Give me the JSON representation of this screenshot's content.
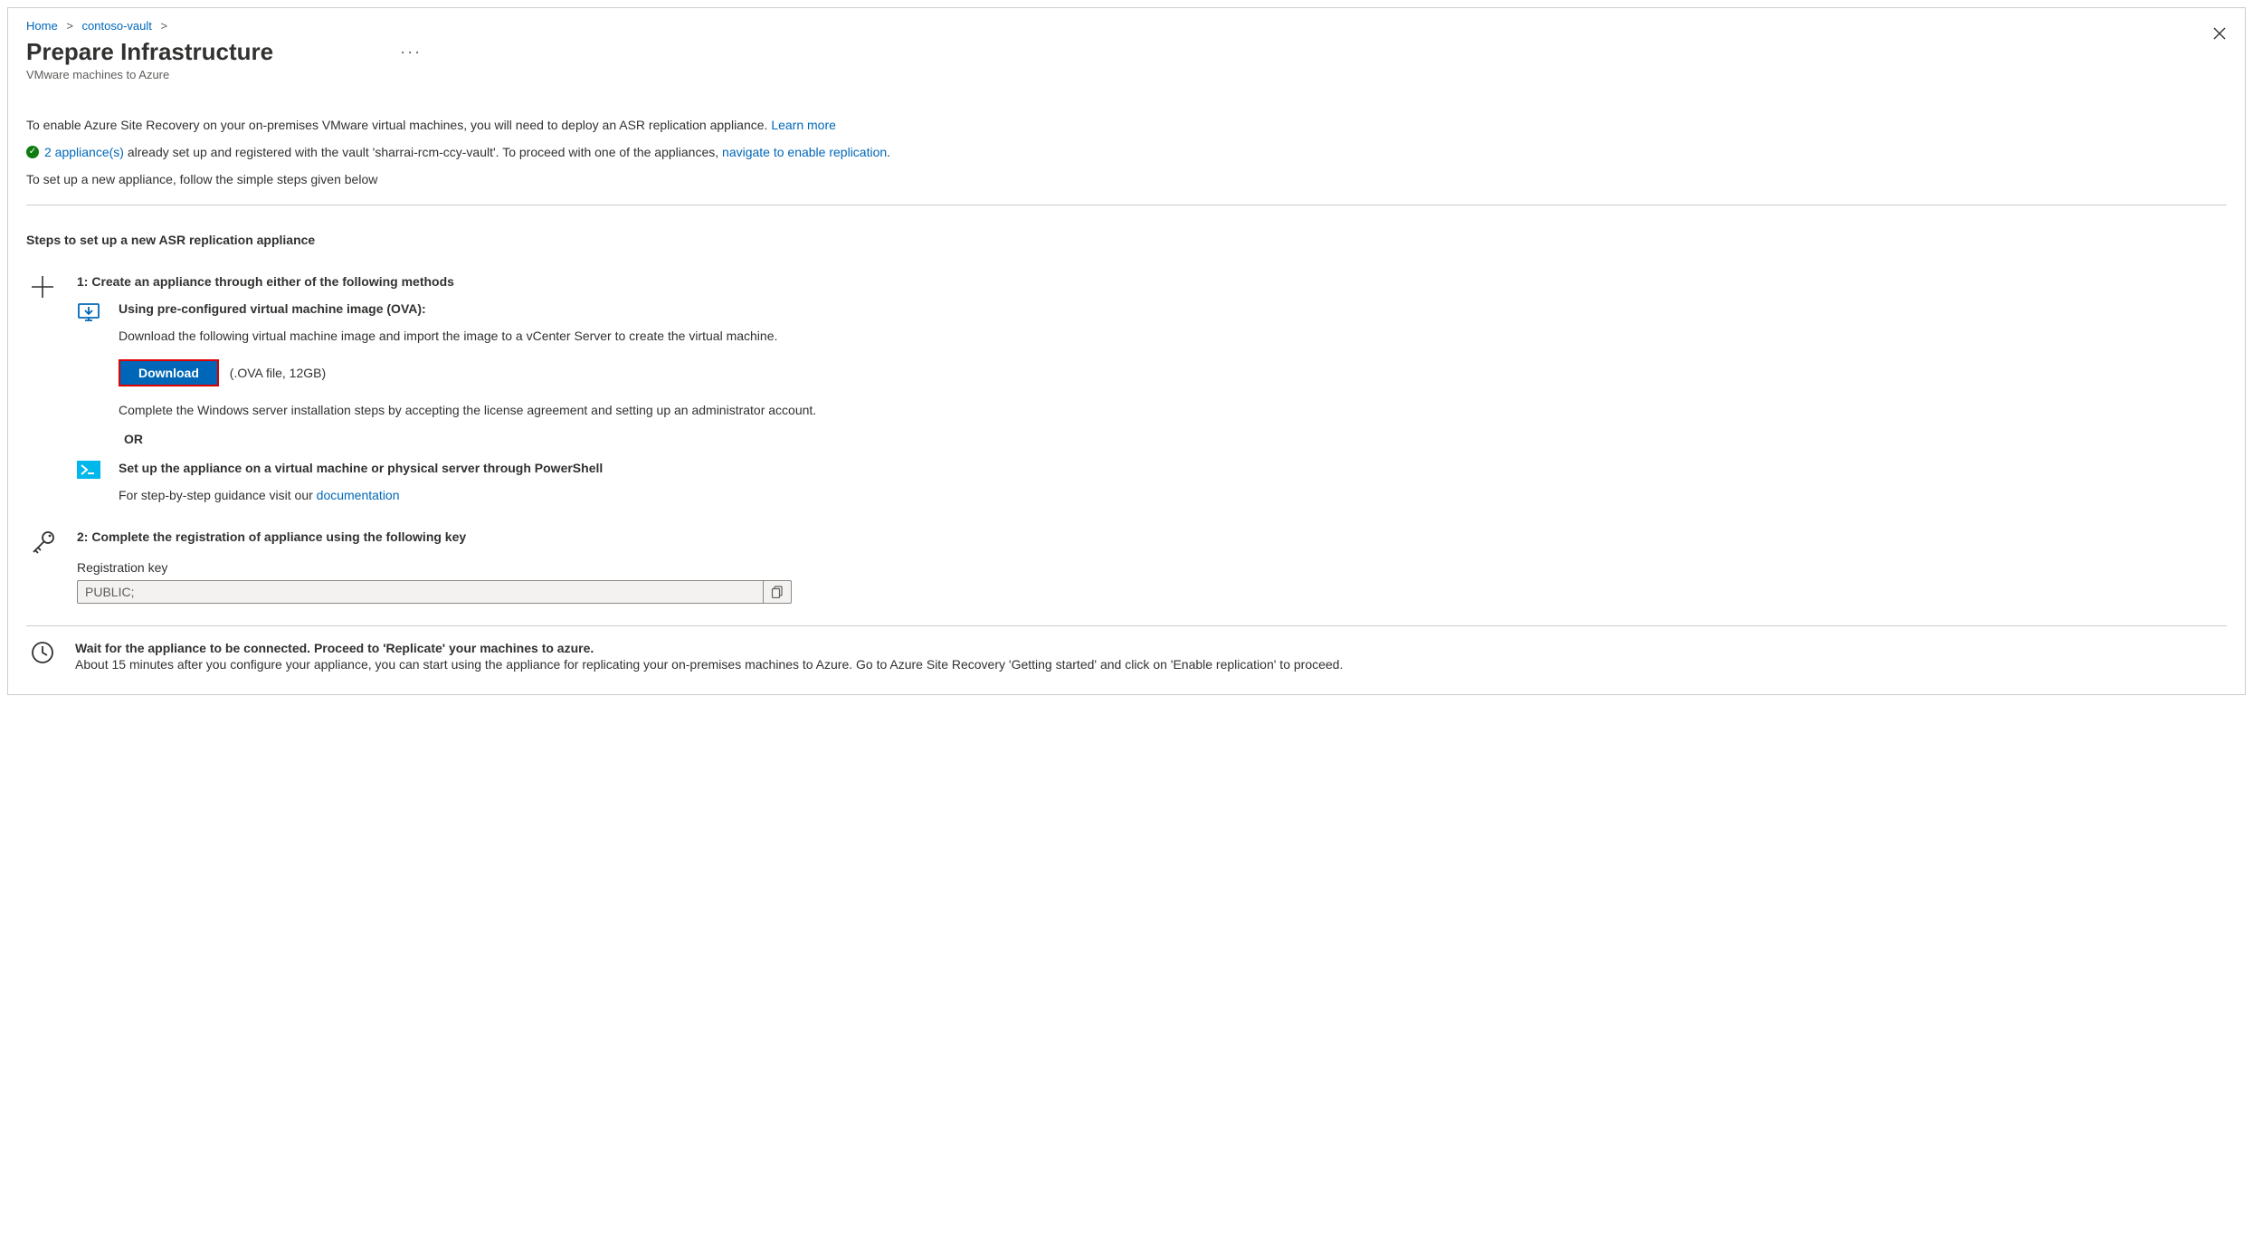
{
  "breadcrumb": {
    "home": "Home",
    "vault": "contoso-vault"
  },
  "header": {
    "title": "Prepare Infrastructure",
    "subtitle": "VMware machines to Azure"
  },
  "intro": {
    "text": "To enable Azure Site Recovery on your on-premises VMware virtual machines, you will need to deploy an ASR replication appliance. ",
    "learn_more": "Learn more"
  },
  "status": {
    "appliances_link": "2 appliance(s)",
    "text_mid": " already set up and registered with the vault 'sharrai-rcm-ccy-vault'. To proceed with one of the appliances, ",
    "navigate_link": "navigate to enable replication",
    "period": "."
  },
  "setup_new": "To set up a new appliance, follow the simple steps given below",
  "steps_heading": "Steps to set up a new ASR replication appliance",
  "step1": {
    "title": "1: Create an appliance through either of the following methods",
    "ova": {
      "title": "Using pre-configured virtual machine image (OVA):",
      "desc": "Download the following virtual machine image and import the image to a vCenter Server to create the virtual machine.",
      "download_label": "Download",
      "download_note": "(.OVA file, 12GB)",
      "complete": "Complete the Windows server installation steps by accepting the license agreement and setting up an administrator account."
    },
    "or": "OR",
    "powershell": {
      "title": "Set up the appliance on a virtual machine or physical server through PowerShell",
      "desc_prefix": "For step-by-step guidance visit our ",
      "doc_link": "documentation"
    }
  },
  "step2": {
    "title": "2: Complete the registration of appliance using the following key",
    "reg_label": "Registration key",
    "reg_value": "PUBLIC;"
  },
  "wait": {
    "title": "Wait for the appliance to be connected. Proceed to 'Replicate' your machines to azure.",
    "desc": "About 15 minutes after you configure your appliance, you can start using the appliance for replicating your on-premises machines to Azure. Go to Azure Site Recovery 'Getting started' and click on 'Enable replication' to proceed."
  }
}
